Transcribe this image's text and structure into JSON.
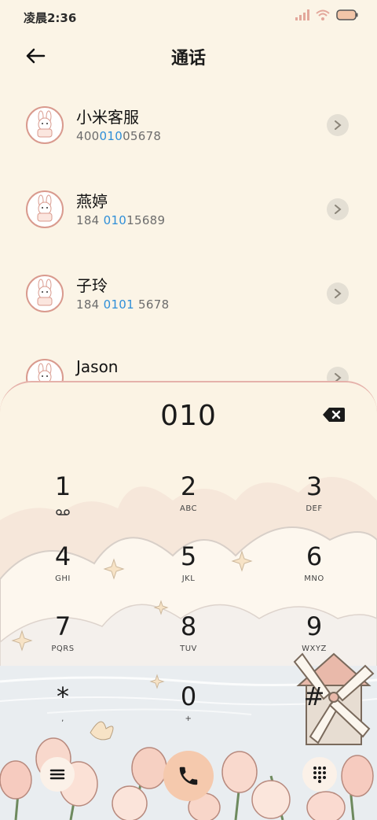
{
  "status_bar": {
    "time": "凌晨2:36"
  },
  "header": {
    "title": "通话"
  },
  "contacts": [
    {
      "name": "小米客服",
      "num_pre": "400",
      "num_hl": "010",
      "num_post": "05678"
    },
    {
      "name": "燕婷",
      "num_pre": "184 ",
      "num_hl": "010",
      "num_post": "15689"
    },
    {
      "name": "子玲",
      "num_pre": "184 ",
      "num_hl": "0101",
      "num_post": " 5678"
    },
    {
      "name": "Jason",
      "num_pre": "",
      "num_hl": "",
      "num_post": ""
    }
  ],
  "dialer": {
    "input": "010",
    "keys": [
      {
        "num": "1",
        "sub": ""
      },
      {
        "num": "2",
        "sub": "ABC"
      },
      {
        "num": "3",
        "sub": "DEF"
      },
      {
        "num": "4",
        "sub": "GHI"
      },
      {
        "num": "5",
        "sub": "JKL"
      },
      {
        "num": "6",
        "sub": "MNO"
      },
      {
        "num": "7",
        "sub": "PQRS"
      },
      {
        "num": "8",
        "sub": "TUV"
      },
      {
        "num": "9",
        "sub": "WXYZ"
      },
      {
        "num": "*",
        "sub": ","
      },
      {
        "num": "0",
        "sub": "+"
      },
      {
        "num": "#",
        "sub": ""
      }
    ]
  },
  "colors": {
    "accent": "#2f8fd8",
    "call_button": "#f5c9ad",
    "background": "#fbf4e6"
  }
}
